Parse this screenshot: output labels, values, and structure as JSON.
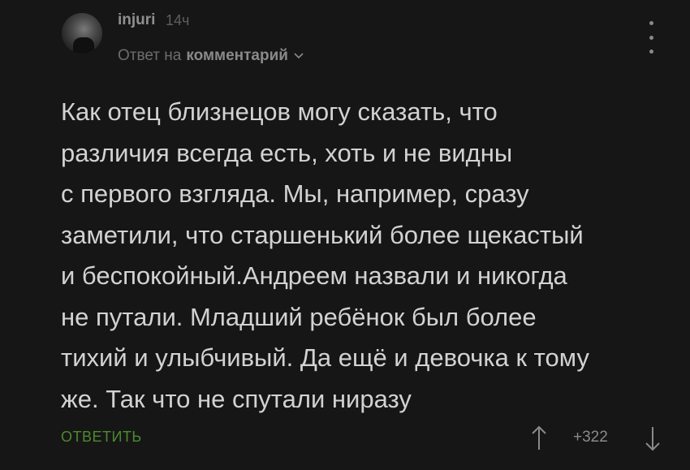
{
  "comment": {
    "author": "injuri",
    "time": "14ч",
    "reply_prefix": "Ответ на",
    "reply_target": "комментарий",
    "text": "Как отец близнецов могу сказать, что\nразличия всегда есть, хоть и не видны\nс первого взгляда. Мы, например, сразу\nзаметили, что старшенький более щекастый\nи беспокойный.Андреем назвали и никогда\nне путали. Младший ребёнок был более\nтихий и улыбчивый. Да ещё и девочка к тому\nже. Так что не спутали ниразу",
    "reply_button": "ОТВЕТИТЬ",
    "rating": "+322"
  },
  "icons": {
    "avatar": "user-avatar-photo",
    "menu": "more-vertical-icon",
    "chevron": "chevron-down-icon",
    "upvote": "arrow-up-icon",
    "downvote": "arrow-down-icon"
  },
  "colors": {
    "background": "#161616",
    "text": "#d2d2d2",
    "accent_green": "#4d8a2f",
    "muted": "#6d6d6d"
  }
}
